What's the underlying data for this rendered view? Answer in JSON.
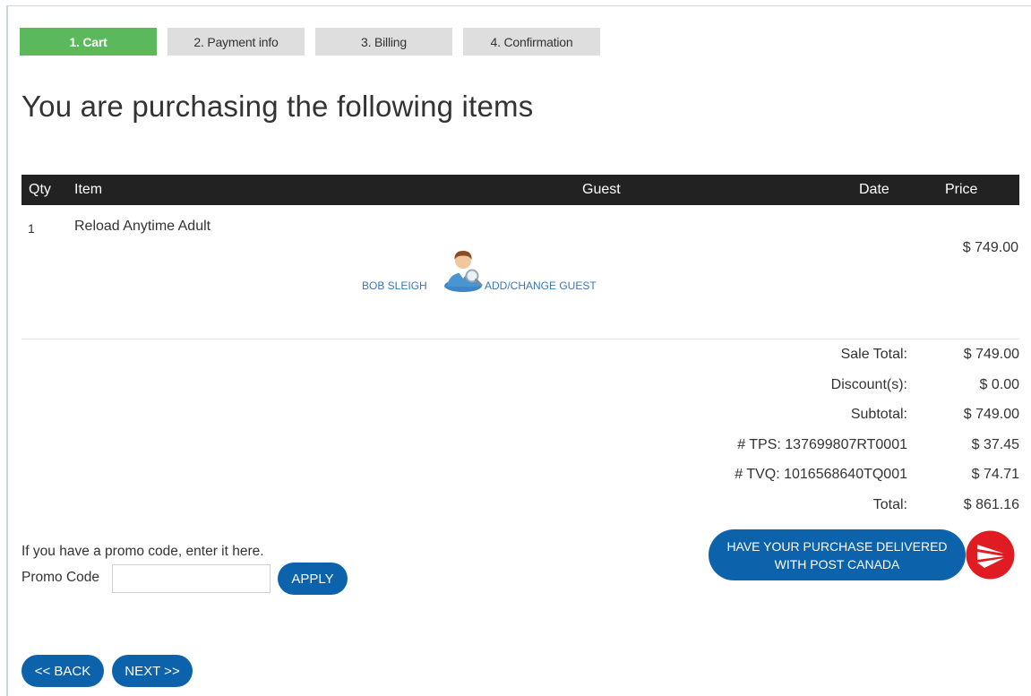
{
  "steps": [
    {
      "label": "1. Cart",
      "active": true
    },
    {
      "label": "2. Payment info",
      "active": false
    },
    {
      "label": "3. Billing",
      "active": false
    },
    {
      "label": "4. Confirmation",
      "active": false
    }
  ],
  "page_title": "You are purchasing the following items",
  "table": {
    "columns": {
      "qty": "Qty",
      "item": "Item",
      "guest": "Guest",
      "date": "Date",
      "price": "Price"
    },
    "rows": [
      {
        "qty": "1",
        "item": "Reload Anytime Adult",
        "guest": "BOB SLEIGH",
        "date": "",
        "price": "$ 749.00"
      }
    ],
    "add_change_guest": "ADD/CHANGE GUEST"
  },
  "totals": [
    {
      "label": "Sale Total:",
      "value": "$ 749.00"
    },
    {
      "label": "Discount(s):",
      "value": "$ 0.00"
    },
    {
      "label": "Subtotal:",
      "value": "$ 749.00"
    },
    {
      "label": "# TPS: 137699807RT0001",
      "value": "$ 37.45"
    },
    {
      "label": "# TVQ: 1016568640TQ001",
      "value": "$ 74.71"
    },
    {
      "label": "Total:",
      "value": "$ 861.16"
    }
  ],
  "promo": {
    "note": "If you have a promo code, enter it here.",
    "label": "Promo Code",
    "value": "",
    "apply_label": "APPLY"
  },
  "delivery": {
    "line1": "HAVE YOUR PURCHASE DELIVERED",
    "line2": "WITH POST CANADA",
    "logo_icon": "canada-post-logo"
  },
  "nav": {
    "back_label": "<< BACK",
    "next_label": "NEXT >>"
  },
  "colors": {
    "step_active": "#5cb85c",
    "step_inactive": "#dedede",
    "header_bg": "#222222",
    "button_blue": "#0d62ac",
    "link_blue": "#3a78b5",
    "post_canada_red": "#e11b22"
  }
}
